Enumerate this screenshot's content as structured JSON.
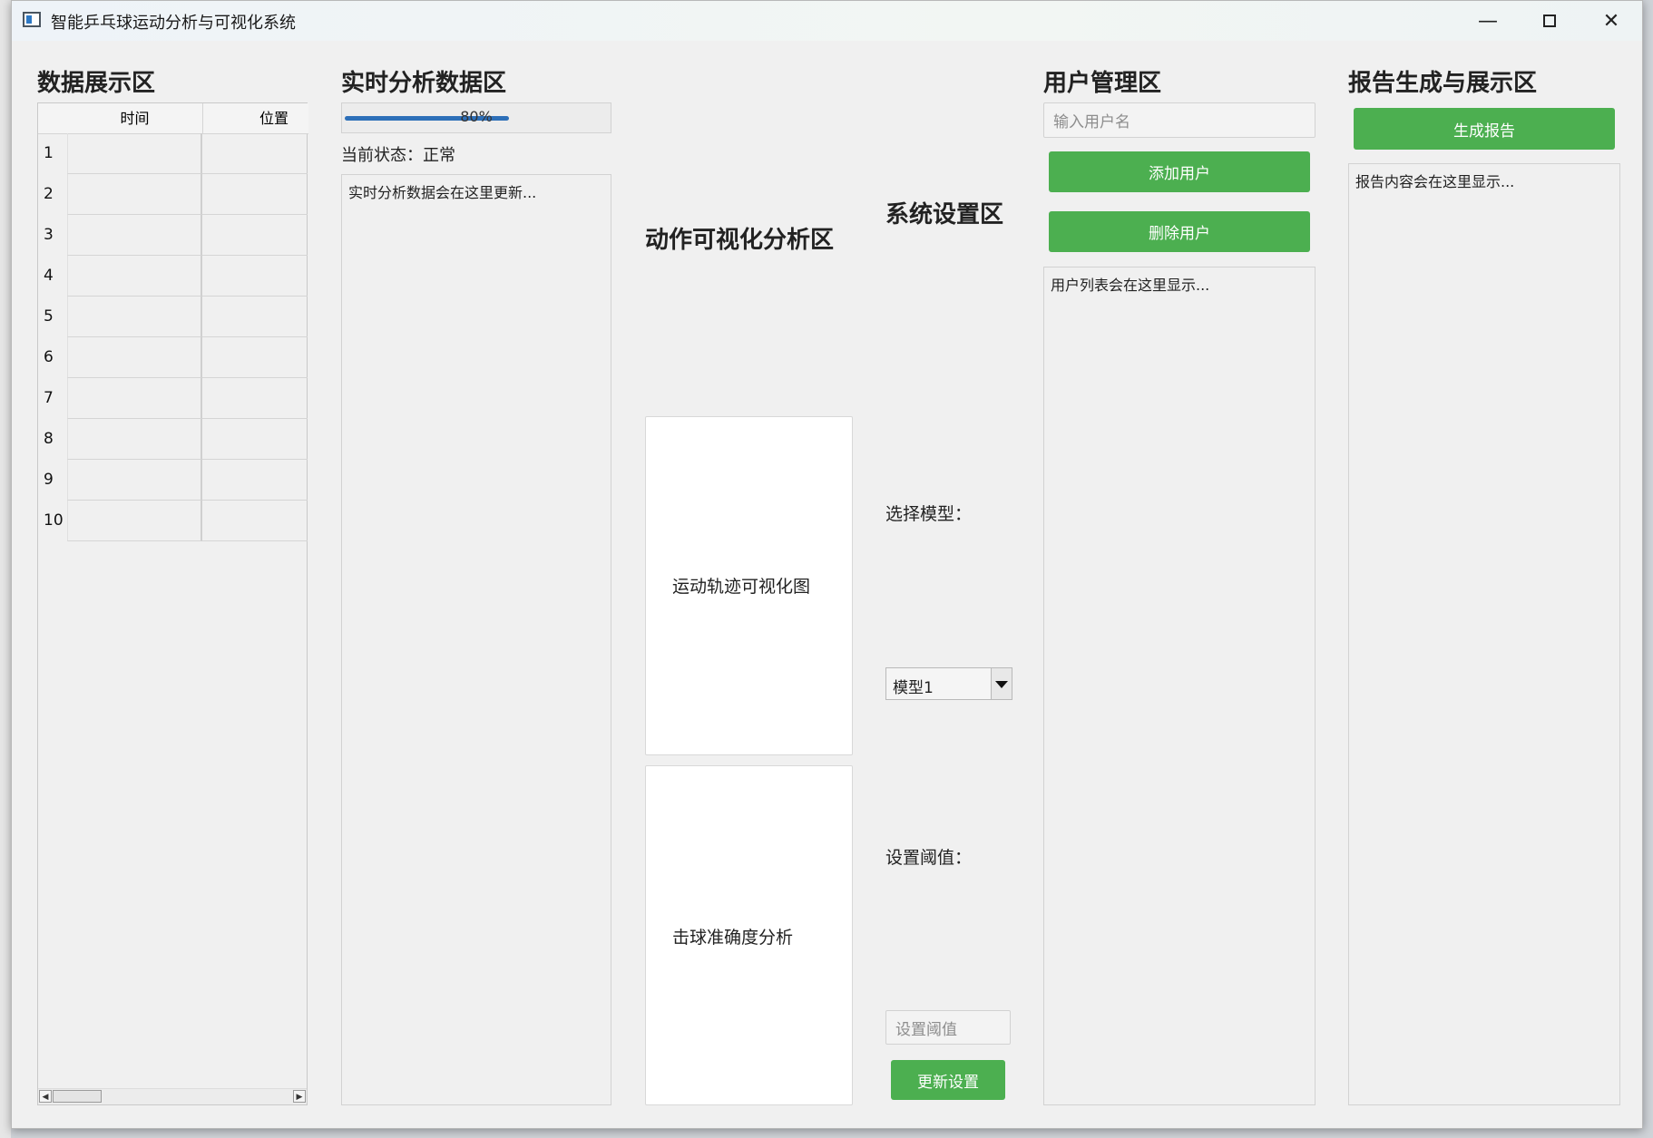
{
  "window": {
    "title": "智能乒乓球运动分析与可视化系统"
  },
  "data_display": {
    "title": "数据展示区",
    "columns": [
      "时间",
      "位置"
    ],
    "row_numbers": [
      "1",
      "2",
      "3",
      "4",
      "5",
      "6",
      "7",
      "8",
      "9",
      "10"
    ]
  },
  "realtime": {
    "title": "实时分析数据区",
    "progress_value": 80,
    "progress_text": "80%",
    "status_text": "当前状态：正常",
    "log_text": "实时分析数据会在这里更新..."
  },
  "visualization": {
    "title": "动作可视化分析区",
    "trajectory_label": "运动轨迹可视化图",
    "accuracy_label": "击球准确度分析"
  },
  "settings": {
    "title": "系统设置区",
    "model_label": "选择模型：",
    "model_value": "模型1",
    "threshold_label": "设置阈值：",
    "threshold_placeholder": "设置阈值",
    "update_button": "更新设置"
  },
  "users": {
    "title": "用户管理区",
    "username_placeholder": "输入用户名",
    "add_button": "添加用户",
    "delete_button": "删除用户",
    "list_text": "用户列表会在这里显示..."
  },
  "report": {
    "title": "报告生成与展示区",
    "generate_button": "生成报告",
    "content_text": "报告内容会在这里显示..."
  },
  "colors": {
    "accent_green": "#4caf50",
    "progress_blue": "#2d6fb8"
  }
}
